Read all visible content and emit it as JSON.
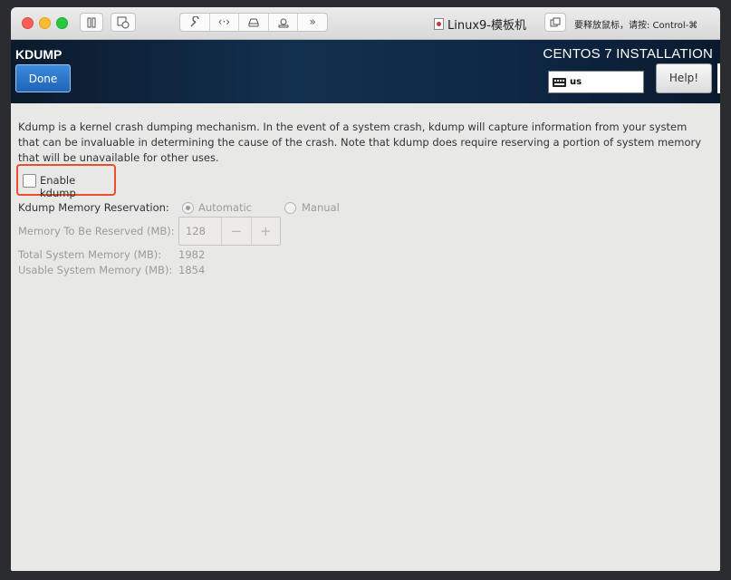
{
  "mac_toolbar": {
    "window_title": "Linux9-模板机",
    "hint": "要释放鼠标，请按: Control-⌘",
    "buttons": [
      "pause-icon",
      "snapshot-icon",
      "settings-wrench-icon",
      "network-arrows-icon",
      "disk-icon",
      "camera-icon",
      "more-chevron-icon",
      "fullscreen-icon"
    ]
  },
  "header": {
    "title": "KDUMP",
    "done_label": "Done",
    "install_title": "CENTOS 7 INSTALLATION",
    "keyboard_layout": "us",
    "help_label": "Help!"
  },
  "content": {
    "description": "Kdump is a kernel crash dumping mechanism. In the event of a system crash, kdump will capture information from your system that can be invaluable in determining the cause of the crash. Note that kdump does require reserving a portion of system memory that will be unavailable for other uses.",
    "enable_label": "Enable kdump",
    "enable_checked": false,
    "reservation_label": "Kdump Memory Reservation:",
    "automatic_label": "Automatic",
    "manual_label": "Manual",
    "reservation_selected": "Automatic",
    "reserved_label": "Memory To Be Reserved (MB):",
    "reserved_value": "128",
    "minus": "−",
    "plus": "+",
    "total_label": "Total System Memory (MB):",
    "total_value": "1982",
    "usable_label": "Usable System Memory (MB):",
    "usable_value": "1854"
  },
  "colors": {
    "header_bg": "#12304f",
    "done_button": "#1e63b6",
    "highlight_border": "#e8502d"
  }
}
